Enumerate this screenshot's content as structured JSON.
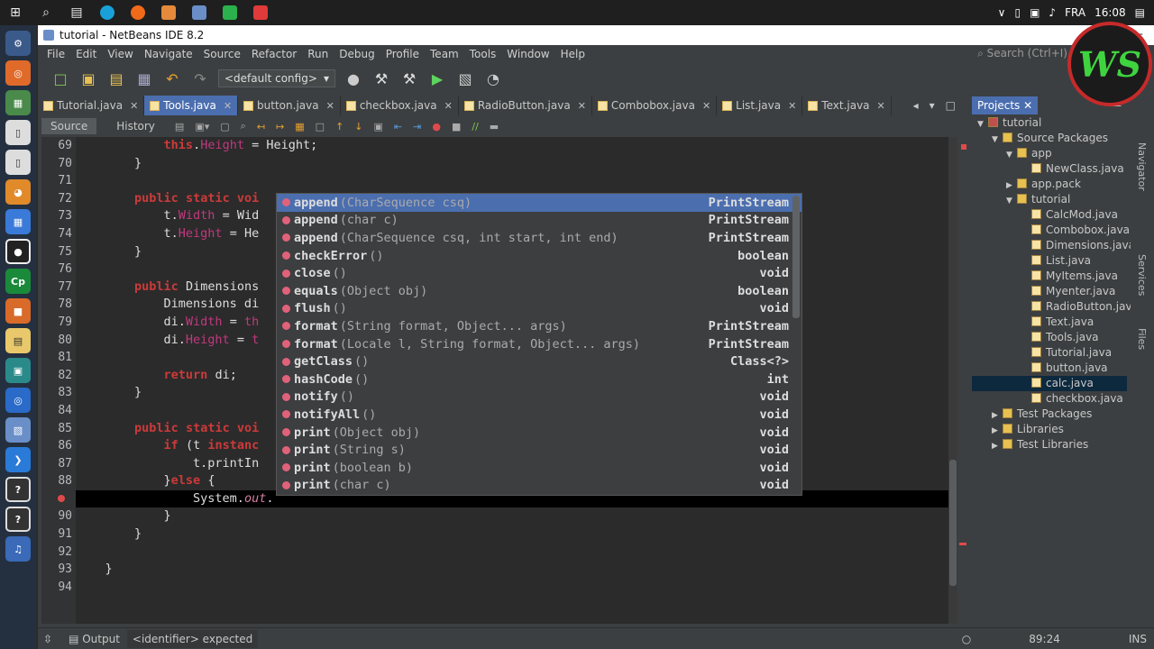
{
  "taskbar": {
    "language": "FRA",
    "time": "16:08"
  },
  "window": {
    "title": "tutorial - NetBeans IDE 8.2"
  },
  "menu": [
    "File",
    "Edit",
    "View",
    "Navigate",
    "Source",
    "Refactor",
    "Run",
    "Debug",
    "Profile",
    "Team",
    "Tools",
    "Window",
    "Help"
  ],
  "search": {
    "placeholder": "Search (Ctrl+I)"
  },
  "toolbar": {
    "config": "<default config>"
  },
  "tabs": [
    {
      "label": "Tutorial.java",
      "active": false
    },
    {
      "label": "Tools.java",
      "active": true
    },
    {
      "label": "button.java",
      "active": false
    },
    {
      "label": "checkbox.java",
      "active": false
    },
    {
      "label": "RadioButton.java",
      "active": false
    },
    {
      "label": "Combobox.java",
      "active": false
    },
    {
      "label": "List.java",
      "active": false
    },
    {
      "label": "Text.java",
      "active": false
    }
  ],
  "editor_toolbar": {
    "source": "Source",
    "history": "History"
  },
  "code": {
    "line_numbers": [
      "69",
      "70",
      "71",
      "72",
      "73",
      "74",
      "75",
      "76",
      "77",
      "78",
      "79",
      "80",
      "81",
      "82",
      "83",
      "84",
      "85",
      "86",
      "87",
      "88",
      "",
      "90",
      "91",
      "92",
      "93",
      "94"
    ],
    "lines": [
      {
        "t": "            this.Height = Height;"
      },
      {
        "t": "        }"
      },
      {
        "t": ""
      },
      {
        "t": "        public static voi"
      },
      {
        "t": "            t.Width = Wid"
      },
      {
        "t": "            t.Height = He"
      },
      {
        "t": "        }"
      },
      {
        "t": ""
      },
      {
        "t": "        public Dimensions"
      },
      {
        "t": "            Dimensions di"
      },
      {
        "t": "            di.Width = th"
      },
      {
        "t": "            di.Height = t"
      },
      {
        "t": ""
      },
      {
        "t": "            return di;"
      },
      {
        "t": "        }"
      },
      {
        "t": ""
      },
      {
        "t": "        public static voi"
      },
      {
        "t": "            if (t instanc"
      },
      {
        "t": "                t.printIn"
      },
      {
        "t": "            }else {"
      },
      {
        "t": "                System.out."
      },
      {
        "t": "            }"
      },
      {
        "t": "        }"
      },
      {
        "t": ""
      },
      {
        "t": "    }"
      },
      {
        "t": ""
      }
    ]
  },
  "completion": {
    "items": [
      {
        "name": "append",
        "args": "(CharSequence csq)",
        "ret": "PrintStream"
      },
      {
        "name": "append",
        "args": "(char c)",
        "ret": "PrintStream"
      },
      {
        "name": "append",
        "args": "(CharSequence csq, int start, int end)",
        "ret": "PrintStream"
      },
      {
        "name": "checkError",
        "args": "()",
        "ret": "boolean"
      },
      {
        "name": "close",
        "args": "()",
        "ret": "void"
      },
      {
        "name": "equals",
        "args": "(Object obj)",
        "ret": "boolean"
      },
      {
        "name": "flush",
        "args": "()",
        "ret": "void"
      },
      {
        "name": "format",
        "args": "(String format, Object... args)",
        "ret": "PrintStream"
      },
      {
        "name": "format",
        "args": "(Locale l, String format, Object... args)",
        "ret": "PrintStream"
      },
      {
        "name": "getClass",
        "args": "()",
        "ret": "Class<?>"
      },
      {
        "name": "hashCode",
        "args": "()",
        "ret": "int"
      },
      {
        "name": "notify",
        "args": "()",
        "ret": "void"
      },
      {
        "name": "notifyAll",
        "args": "()",
        "ret": "void"
      },
      {
        "name": "print",
        "args": "(Object obj)",
        "ret": "void"
      },
      {
        "name": "print",
        "args": "(String s)",
        "ret": "void"
      },
      {
        "name": "print",
        "args": "(boolean b)",
        "ret": "void"
      },
      {
        "name": "print",
        "args": "(char c)",
        "ret": "void"
      }
    ]
  },
  "projects": {
    "tab": "Projects",
    "tree": [
      {
        "label": "tutorial",
        "depth": 0,
        "kind": "project"
      },
      {
        "label": "Source Packages",
        "depth": 1,
        "kind": "folder"
      },
      {
        "label": "app",
        "depth": 2,
        "kind": "package"
      },
      {
        "label": "NewClass.java",
        "depth": 3,
        "kind": "file"
      },
      {
        "label": "app.pack",
        "depth": 2,
        "kind": "package"
      },
      {
        "label": "tutorial",
        "depth": 2,
        "kind": "package"
      },
      {
        "label": "CalcMod.java",
        "depth": 3,
        "kind": "file"
      },
      {
        "label": "Combobox.java",
        "depth": 3,
        "kind": "file"
      },
      {
        "label": "Dimensions.java",
        "depth": 3,
        "kind": "file"
      },
      {
        "label": "List.java",
        "depth": 3,
        "kind": "file"
      },
      {
        "label": "MyItems.java",
        "depth": 3,
        "kind": "file"
      },
      {
        "label": "Myenter.java",
        "depth": 3,
        "kind": "file"
      },
      {
        "label": "RadioButton.java",
        "depth": 3,
        "kind": "file"
      },
      {
        "label": "Text.java",
        "depth": 3,
        "kind": "file"
      },
      {
        "label": "Tools.java",
        "depth": 3,
        "kind": "file"
      },
      {
        "label": "Tutorial.java",
        "depth": 3,
        "kind": "file"
      },
      {
        "label": "button.java",
        "depth": 3,
        "kind": "file"
      },
      {
        "label": "calc.java",
        "depth": 3,
        "kind": "file",
        "selected": true
      },
      {
        "label": "checkbox.java",
        "depth": 3,
        "kind": "file"
      },
      {
        "label": "Test Packages",
        "depth": 1,
        "kind": "folder"
      },
      {
        "label": "Libraries",
        "depth": 1,
        "kind": "folder"
      },
      {
        "label": "Test Libraries",
        "depth": 1,
        "kind": "folder"
      }
    ]
  },
  "side_panels": [
    "Navigator",
    "Services",
    "Files"
  ],
  "status": {
    "output": "Output",
    "message": "<identifier> expected",
    "position": "89:24",
    "mode": "INS"
  },
  "logo_text": "WS"
}
